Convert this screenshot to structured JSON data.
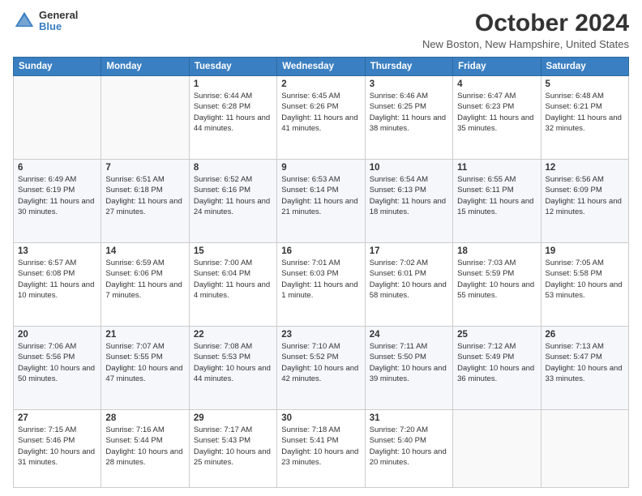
{
  "logo": {
    "general": "General",
    "blue": "Blue"
  },
  "title": "October 2024",
  "location": "New Boston, New Hampshire, United States",
  "weekdays": [
    "Sunday",
    "Monday",
    "Tuesday",
    "Wednesday",
    "Thursday",
    "Friday",
    "Saturday"
  ],
  "weeks": [
    [
      {
        "day": "",
        "empty": true
      },
      {
        "day": "",
        "empty": true
      },
      {
        "day": "1",
        "sunrise": "6:44 AM",
        "sunset": "6:28 PM",
        "daylight": "11 hours and 44 minutes."
      },
      {
        "day": "2",
        "sunrise": "6:45 AM",
        "sunset": "6:26 PM",
        "daylight": "11 hours and 41 minutes."
      },
      {
        "day": "3",
        "sunrise": "6:46 AM",
        "sunset": "6:25 PM",
        "daylight": "11 hours and 38 minutes."
      },
      {
        "day": "4",
        "sunrise": "6:47 AM",
        "sunset": "6:23 PM",
        "daylight": "11 hours and 35 minutes."
      },
      {
        "day": "5",
        "sunrise": "6:48 AM",
        "sunset": "6:21 PM",
        "daylight": "11 hours and 32 minutes."
      }
    ],
    [
      {
        "day": "6",
        "sunrise": "6:49 AM",
        "sunset": "6:19 PM",
        "daylight": "11 hours and 30 minutes."
      },
      {
        "day": "7",
        "sunrise": "6:51 AM",
        "sunset": "6:18 PM",
        "daylight": "11 hours and 27 minutes."
      },
      {
        "day": "8",
        "sunrise": "6:52 AM",
        "sunset": "6:16 PM",
        "daylight": "11 hours and 24 minutes."
      },
      {
        "day": "9",
        "sunrise": "6:53 AM",
        "sunset": "6:14 PM",
        "daylight": "11 hours and 21 minutes."
      },
      {
        "day": "10",
        "sunrise": "6:54 AM",
        "sunset": "6:13 PM",
        "daylight": "11 hours and 18 minutes."
      },
      {
        "day": "11",
        "sunrise": "6:55 AM",
        "sunset": "6:11 PM",
        "daylight": "11 hours and 15 minutes."
      },
      {
        "day": "12",
        "sunrise": "6:56 AM",
        "sunset": "6:09 PM",
        "daylight": "11 hours and 12 minutes."
      }
    ],
    [
      {
        "day": "13",
        "sunrise": "6:57 AM",
        "sunset": "6:08 PM",
        "daylight": "11 hours and 10 minutes."
      },
      {
        "day": "14",
        "sunrise": "6:59 AM",
        "sunset": "6:06 PM",
        "daylight": "11 hours and 7 minutes."
      },
      {
        "day": "15",
        "sunrise": "7:00 AM",
        "sunset": "6:04 PM",
        "daylight": "11 hours and 4 minutes."
      },
      {
        "day": "16",
        "sunrise": "7:01 AM",
        "sunset": "6:03 PM",
        "daylight": "11 hours and 1 minute."
      },
      {
        "day": "17",
        "sunrise": "7:02 AM",
        "sunset": "6:01 PM",
        "daylight": "10 hours and 58 minutes."
      },
      {
        "day": "18",
        "sunrise": "7:03 AM",
        "sunset": "5:59 PM",
        "daylight": "10 hours and 55 minutes."
      },
      {
        "day": "19",
        "sunrise": "7:05 AM",
        "sunset": "5:58 PM",
        "daylight": "10 hours and 53 minutes."
      }
    ],
    [
      {
        "day": "20",
        "sunrise": "7:06 AM",
        "sunset": "5:56 PM",
        "daylight": "10 hours and 50 minutes."
      },
      {
        "day": "21",
        "sunrise": "7:07 AM",
        "sunset": "5:55 PM",
        "daylight": "10 hours and 47 minutes."
      },
      {
        "day": "22",
        "sunrise": "7:08 AM",
        "sunset": "5:53 PM",
        "daylight": "10 hours and 44 minutes."
      },
      {
        "day": "23",
        "sunrise": "7:10 AM",
        "sunset": "5:52 PM",
        "daylight": "10 hours and 42 minutes."
      },
      {
        "day": "24",
        "sunrise": "7:11 AM",
        "sunset": "5:50 PM",
        "daylight": "10 hours and 39 minutes."
      },
      {
        "day": "25",
        "sunrise": "7:12 AM",
        "sunset": "5:49 PM",
        "daylight": "10 hours and 36 minutes."
      },
      {
        "day": "26",
        "sunrise": "7:13 AM",
        "sunset": "5:47 PM",
        "daylight": "10 hours and 33 minutes."
      }
    ],
    [
      {
        "day": "27",
        "sunrise": "7:15 AM",
        "sunset": "5:46 PM",
        "daylight": "10 hours and 31 minutes."
      },
      {
        "day": "28",
        "sunrise": "7:16 AM",
        "sunset": "5:44 PM",
        "daylight": "10 hours and 28 minutes."
      },
      {
        "day": "29",
        "sunrise": "7:17 AM",
        "sunset": "5:43 PM",
        "daylight": "10 hours and 25 minutes."
      },
      {
        "day": "30",
        "sunrise": "7:18 AM",
        "sunset": "5:41 PM",
        "daylight": "10 hours and 23 minutes."
      },
      {
        "day": "31",
        "sunrise": "7:20 AM",
        "sunset": "5:40 PM",
        "daylight": "10 hours and 20 minutes."
      },
      {
        "day": "",
        "empty": true
      },
      {
        "day": "",
        "empty": true
      }
    ]
  ]
}
